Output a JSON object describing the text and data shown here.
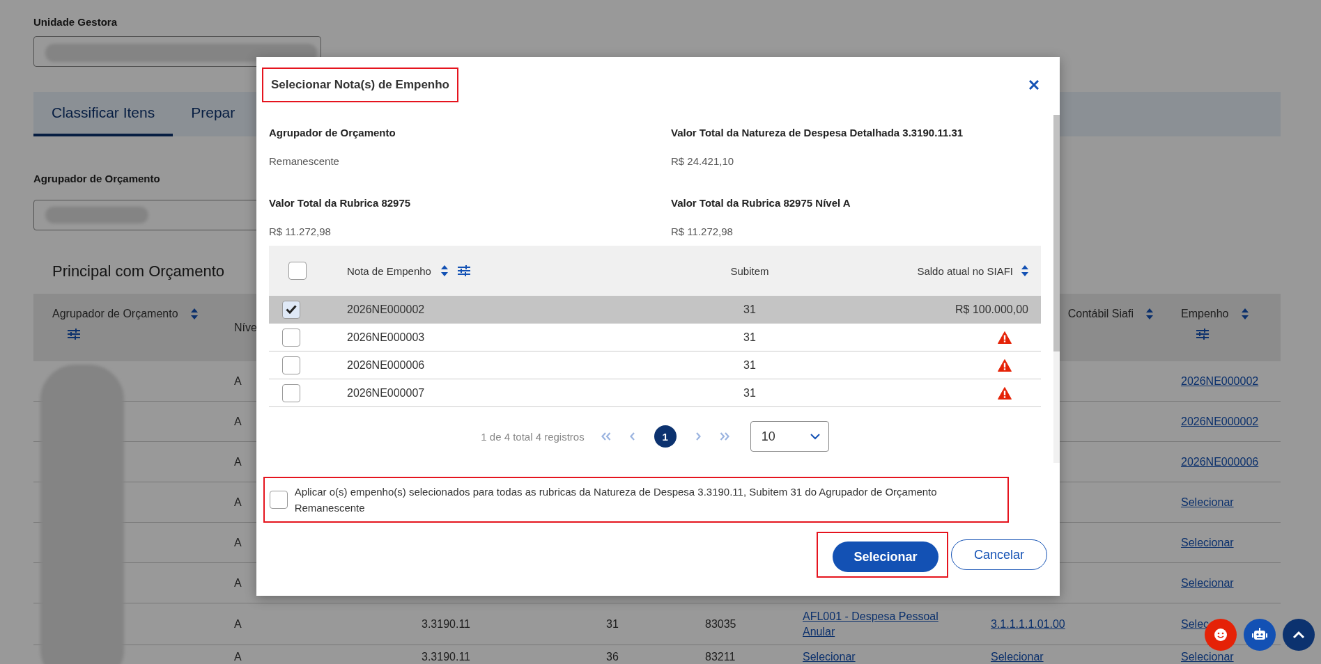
{
  "page": {
    "unit_field": {
      "label": "Unidade Gestora"
    },
    "tabs": [
      {
        "label": "Classificar Itens",
        "selected": true
      },
      {
        "label": "Prepar",
        "selected": false
      }
    ],
    "budget_group_field": {
      "label": "Agrupador de Orçamento"
    },
    "section_title": "Principal com Orçamento",
    "table": {
      "columns": [
        {
          "label": "Agrupador de Orçamento",
          "sortable": true,
          "filterable": true
        },
        {
          "label": "Níve",
          "sortable": false,
          "filterable": false
        },
        {
          "label": "Contábil Siafi",
          "sortable": true,
          "filterable": false
        },
        {
          "label": "Empenho",
          "sortable": true,
          "filterable": true
        }
      ],
      "rows": [
        {
          "nivel": "A",
          "empenho": "2026NE000002"
        },
        {
          "nivel": "A",
          "empenho": "2026NE000002"
        },
        {
          "nivel": "A",
          "empenho": "2026NE000006"
        },
        {
          "nivel": "A",
          "empenho": "Selecionar"
        },
        {
          "nivel": "A",
          "empenho": "Selecionar"
        },
        {
          "nivel": "A",
          "empenho": "Selecionar"
        },
        {
          "nivel": "A",
          "column_3": "3.3190.11",
          "column_4": "31",
          "column_5": "83035",
          "column_6": "AFL001 - Despesa Pessoal Anular",
          "column_7": "3.1.1.1.1.01.00",
          "empenho": "Selec"
        },
        {
          "nivel": "A",
          "column_3": "3.3190.11",
          "column_4": "36",
          "column_5": "83211",
          "column_6": "Selecionar",
          "column_7": "Selecionar",
          "empenho": "Selecionar"
        }
      ]
    }
  },
  "modal": {
    "title": "Selecionar Nota(s) de Empenho",
    "title_highlighted": true,
    "summary": [
      {
        "label": "Agrupador de Orçamento",
        "value": "Remanescente"
      },
      {
        "label": "Valor Total da Natureza de Despesa Detalhada 3.3190.11.31",
        "value": "R$ 24.421,10"
      },
      {
        "label": "Valor Total da Rubrica 82975",
        "value": "R$ 11.272,98"
      },
      {
        "label": "Valor Total da Rubrica 82975 Nível A",
        "value": "R$ 11.272,98"
      }
    ],
    "table": {
      "select_all_checked": false,
      "columns": [
        {
          "label": "Nota de Empenho",
          "sortable": true,
          "filterable": true
        },
        {
          "label": "Subitem",
          "sortable": false,
          "filterable": false
        },
        {
          "label": "Saldo atual no SIAFI",
          "sortable": true,
          "filterable": false
        }
      ],
      "rows": [
        {
          "checked": true,
          "nota": "2026NE000002",
          "subitem": "31",
          "saldo": "R$ 100.000,00",
          "warning": false
        },
        {
          "checked": false,
          "nota": "2026NE000003",
          "subitem": "31",
          "warning": true
        },
        {
          "checked": false,
          "nota": "2026NE000006",
          "subitem": "31",
          "warning": true
        },
        {
          "checked": false,
          "nota": "2026NE000007",
          "subitem": "31",
          "warning": true
        }
      ]
    },
    "pagination": {
      "summary": "1 de 4 total 4 registros",
      "pages": [
        {
          "label": "1",
          "selected": true
        }
      ],
      "page_size": "10"
    },
    "apply_option": {
      "label": "Aplicar o(s) empenho(s) selecionados para todas as rubricas da Natureza de Despesa 3.3190.11, Subitem 31 do Agrupador de Orçamento Remanescente",
      "checked": false,
      "highlighted": true
    },
    "buttons": [
      {
        "label": "Selecionar",
        "kind": "primary",
        "highlighted": true
      },
      {
        "label": "Cancelar",
        "kind": "secondary",
        "highlighted": false
      }
    ]
  }
}
